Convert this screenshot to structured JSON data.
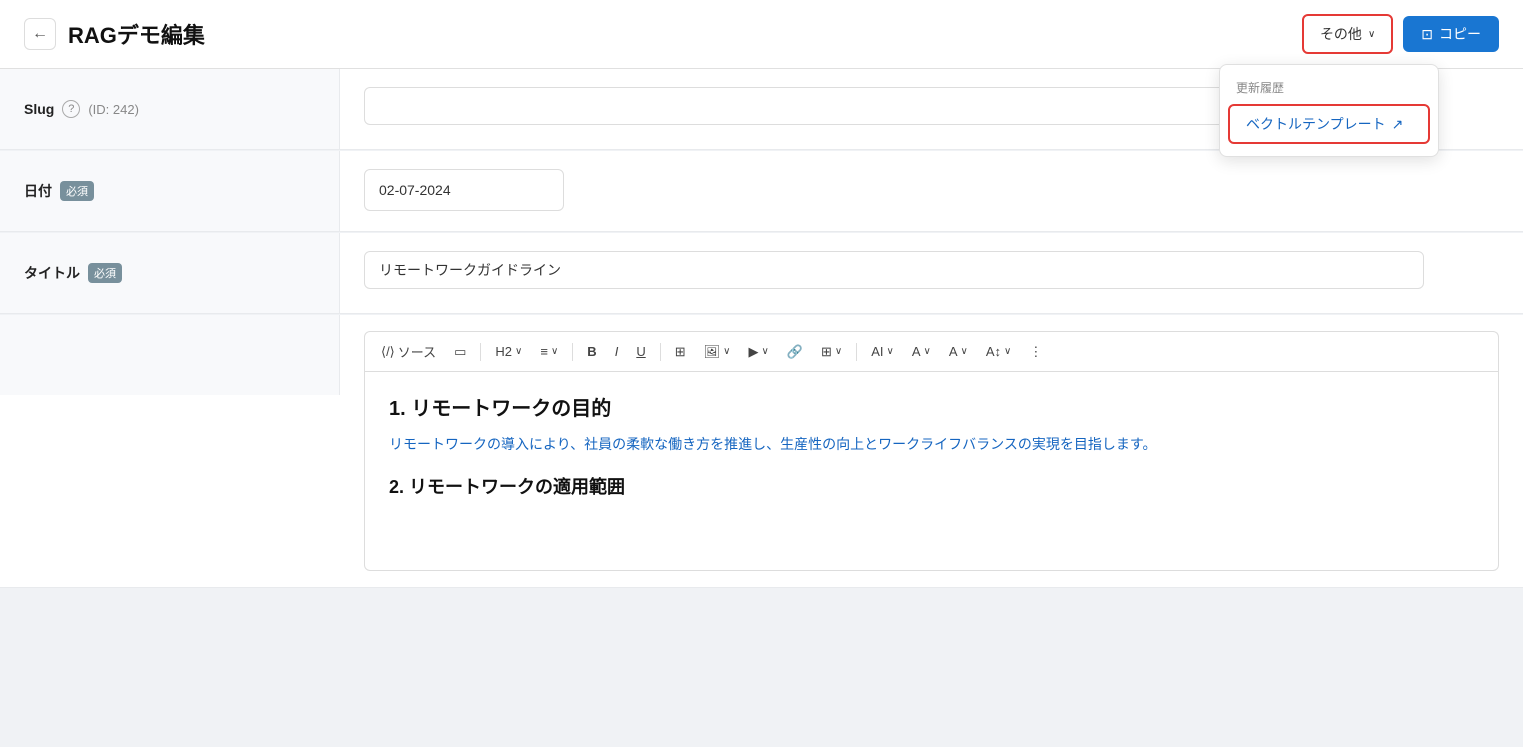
{
  "header": {
    "back_label": "←",
    "title": "RAGデモ編集",
    "btn_other": "その他",
    "btn_copy": "コピー",
    "copy_icon": "⊡"
  },
  "dropdown": {
    "section_label": "更新履歴",
    "item_label": "ベクトルテンプレート",
    "item_icon": "↗"
  },
  "fields": {
    "slug": {
      "label": "Slug",
      "id_text": "(ID: 242)",
      "placeholder": "",
      "value": ""
    },
    "date": {
      "label": "日付",
      "badge": "必須",
      "value": "02-07-2024",
      "calendar_icon": "📅"
    },
    "title": {
      "label": "タイトル",
      "badge": "必須",
      "value": "リモートワークガイドライン"
    }
  },
  "editor": {
    "toolbar": {
      "source": "ソース",
      "monitor_icon": "🖥",
      "heading": "H2",
      "align": "≡",
      "bold": "B",
      "italic": "I",
      "underline": "U",
      "add_image": "⊞",
      "image": "🖼",
      "video": "▶",
      "link": "🔗",
      "table": "⊞",
      "ai_text": "AI",
      "font_color": "A",
      "highlight": "A",
      "font_size": "A↕",
      "more": "⋮"
    },
    "content": {
      "h1": "1. リモートワークの目的",
      "para1": "リモートワークの導入により、社員の柔軟な働き方を推進し、生産性の向上とワークライフバランスの実現を目指します。",
      "h2": "2. リモートワークの適用範囲"
    }
  }
}
